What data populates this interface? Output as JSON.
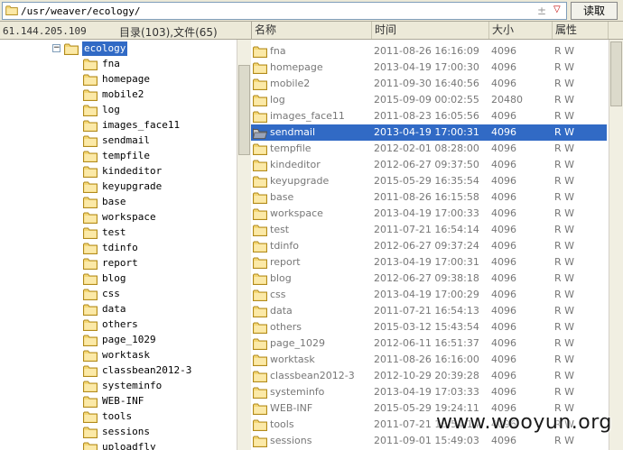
{
  "address": {
    "path": "/usr/weaver/ecology/",
    "read_label": "读取",
    "plus_glyph": "±",
    "dropdown_glyph": "▽"
  },
  "status": {
    "ip": "61.144.205.109",
    "counts": "目录(103),文件(65)"
  },
  "columns": {
    "name": "名称",
    "time": "时间",
    "size": "大小",
    "attr": "属性"
  },
  "tree": {
    "expander": "−",
    "root": "ecology",
    "children": [
      "fna",
      "homepage",
      "mobile2",
      "log",
      "images_face11",
      "sendmail",
      "tempfile",
      "kindeditor",
      "keyupgrade",
      "base",
      "workspace",
      "test",
      "tdinfo",
      "report",
      "blog",
      "css",
      "data",
      "others",
      "page_1029",
      "worktask",
      "classbean2012-3",
      "systeminfo",
      "WEB-INF",
      "tools",
      "sessions",
      "uploadfly"
    ]
  },
  "files": [
    {
      "name": "fna",
      "time": "2011-08-26 16:16:09",
      "size": "4096",
      "attr": "R W"
    },
    {
      "name": "homepage",
      "time": "2013-04-19 17:00:30",
      "size": "4096",
      "attr": "R W"
    },
    {
      "name": "mobile2",
      "time": "2011-09-30 16:40:56",
      "size": "4096",
      "attr": "R W"
    },
    {
      "name": "log",
      "time": "2015-09-09 00:02:55",
      "size": "20480",
      "attr": "R W"
    },
    {
      "name": "images_face11",
      "time": "2011-08-23 16:05:56",
      "size": "4096",
      "attr": "R W"
    },
    {
      "name": "sendmail",
      "time": "2013-04-19 17:00:31",
      "size": "4096",
      "attr": "R W",
      "selected": true
    },
    {
      "name": "tempfile",
      "time": "2012-02-01 08:28:00",
      "size": "4096",
      "attr": "R W"
    },
    {
      "name": "kindeditor",
      "time": "2012-06-27 09:37:50",
      "size": "4096",
      "attr": "R W"
    },
    {
      "name": "keyupgrade",
      "time": "2015-05-29 16:35:54",
      "size": "4096",
      "attr": "R W"
    },
    {
      "name": "base",
      "time": "2011-08-26 16:15:58",
      "size": "4096",
      "attr": "R W"
    },
    {
      "name": "workspace",
      "time": "2013-04-19 17:00:33",
      "size": "4096",
      "attr": "R W"
    },
    {
      "name": "test",
      "time": "2011-07-21 16:54:14",
      "size": "4096",
      "attr": "R W"
    },
    {
      "name": "tdinfo",
      "time": "2012-06-27 09:37:24",
      "size": "4096",
      "attr": "R W"
    },
    {
      "name": "report",
      "time": "2013-04-19 17:00:31",
      "size": "4096",
      "attr": "R W"
    },
    {
      "name": "blog",
      "time": "2012-06-27 09:38:18",
      "size": "4096",
      "attr": "R W"
    },
    {
      "name": "css",
      "time": "2013-04-19 17:00:29",
      "size": "4096",
      "attr": "R W"
    },
    {
      "name": "data",
      "time": "2011-07-21 16:54:13",
      "size": "4096",
      "attr": "R W"
    },
    {
      "name": "others",
      "time": "2015-03-12 15:43:54",
      "size": "4096",
      "attr": "R W"
    },
    {
      "name": "page_1029",
      "time": "2012-06-11 16:51:37",
      "size": "4096",
      "attr": "R W"
    },
    {
      "name": "worktask",
      "time": "2011-08-26 16:16:00",
      "size": "4096",
      "attr": "R W"
    },
    {
      "name": "classbean2012-3",
      "time": "2012-10-29 20:39:28",
      "size": "4096",
      "attr": "R W"
    },
    {
      "name": "systeminfo",
      "time": "2013-04-19 17:03:33",
      "size": "4096",
      "attr": "R W"
    },
    {
      "name": "WEB-INF",
      "time": "2015-05-29 19:24:11",
      "size": "4096",
      "attr": "R W"
    },
    {
      "name": "tools",
      "time": "2011-07-21 16:54:14",
      "size": "4096",
      "attr": "R W"
    },
    {
      "name": "sessions",
      "time": "2011-09-01 15:49:03",
      "size": "4096",
      "attr": "R W"
    }
  ],
  "watermark": "www.wooyun.org",
  "colors": {
    "selection": "#316ac5",
    "folder_fill": "#f5d774",
    "folder_edge": "#b08a1e",
    "chrome": "#ece9d8"
  }
}
